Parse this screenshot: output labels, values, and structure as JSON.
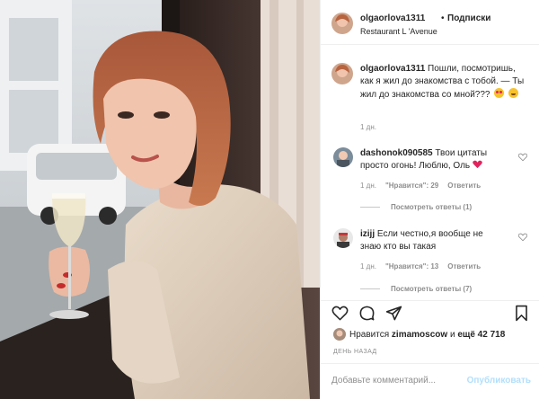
{
  "post": {
    "author": "olgaorlova1311",
    "separator": "•",
    "follow_label": "Подписки",
    "location": "Restaurant L 'Avenue"
  },
  "caption": {
    "username": "olgaorlova1311",
    "text": "Пошли, посмотришь, как я жил до знакомства с тобой. — Ты жил до знакомства со мной???",
    "emoji": [
      "heart-eyes-emoji",
      "grinning-sweat-emoji"
    ],
    "time": "1 дн."
  },
  "comments": [
    {
      "username": "dashonok090585",
      "text": "Твои цитаты просто огонь! Люблю, Оль",
      "time": "1 дн.",
      "likes": "\"Нравится\": 29",
      "reply": "Ответить",
      "view_replies": "Посмотреть ответы (1)"
    },
    {
      "username": "izijj",
      "text": "Если честно,я вообще не знаю кто вы такая",
      "time": "1 дн.",
      "likes": "\"Нравится\": 13",
      "reply": "Ответить",
      "view_replies": "Посмотреть ответы (7)"
    }
  ],
  "likes": {
    "prefix": "Нравится",
    "user": "zimamoscow",
    "conj": "и",
    "more": "ещё 42 718"
  },
  "date": "ДЕНЬ НАЗАД",
  "comment_input": {
    "placeholder": "Добавьте комментарий...",
    "publish": "Опубликовать"
  },
  "colors": {
    "text": "#262626",
    "secondary": "#8e8e8e",
    "publish_disabled": "#b2dffc",
    "heart": "#ed4956"
  }
}
